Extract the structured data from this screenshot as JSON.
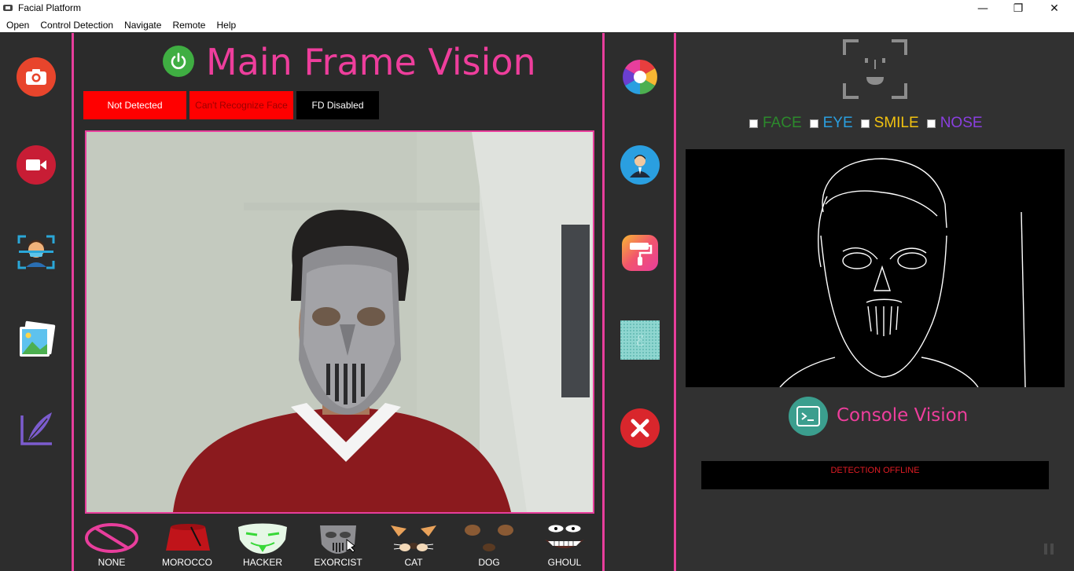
{
  "window": {
    "title": "Facial Platform",
    "controls": {
      "minimize": "—",
      "maximize": "❐",
      "close": "✕"
    }
  },
  "menu": [
    "Open",
    "Control Detection",
    "Navigate",
    "Remote",
    "Help"
  ],
  "left_toolbar": [
    {
      "name": "camera-icon",
      "color": "#e8452c"
    },
    {
      "name": "video-icon",
      "color": "#d0203a"
    },
    {
      "name": "face-scan-icon",
      "color": "#2aa7d8"
    },
    {
      "name": "gallery-icon",
      "color": "#3aa8e0"
    },
    {
      "name": "quill-icon",
      "color": "#7c5ccf"
    }
  ],
  "main": {
    "title": "Main Frame Vision",
    "status": [
      {
        "text": "Not Detected",
        "bg": "#ff0000",
        "fg": "#ffffff"
      },
      {
        "text": "Can't Recognize Face",
        "bg": "#ff0000",
        "fg": "#9b0000"
      },
      {
        "text": "FD Disabled",
        "bg": "#000000",
        "fg": "#ffffff"
      }
    ],
    "filters": [
      "NONE",
      "MOROCCO",
      "HACKER",
      "EXORCIST",
      "CAT",
      "DOG",
      "GHOUL"
    ]
  },
  "mid_toolbar": [
    {
      "name": "color-wheel-icon"
    },
    {
      "name": "user-profile-icon"
    },
    {
      "name": "paint-roller-icon"
    },
    {
      "name": "pattern-icon"
    },
    {
      "name": "close-icon",
      "color": "#d9262c"
    }
  ],
  "right": {
    "detectors": [
      {
        "label": "FACE",
        "color": "#2c8a2c"
      },
      {
        "label": "EYE",
        "color": "#2a9fe0"
      },
      {
        "label": "SMILE",
        "color": "#f2c20f"
      },
      {
        "label": "NOSE",
        "color": "#8a3fe0"
      }
    ],
    "console_title": "Console Vision",
    "console_message": "DETECTION OFFLINE"
  },
  "colors": {
    "accent": "#ee3e9c",
    "panel": "#2b2b2b"
  }
}
